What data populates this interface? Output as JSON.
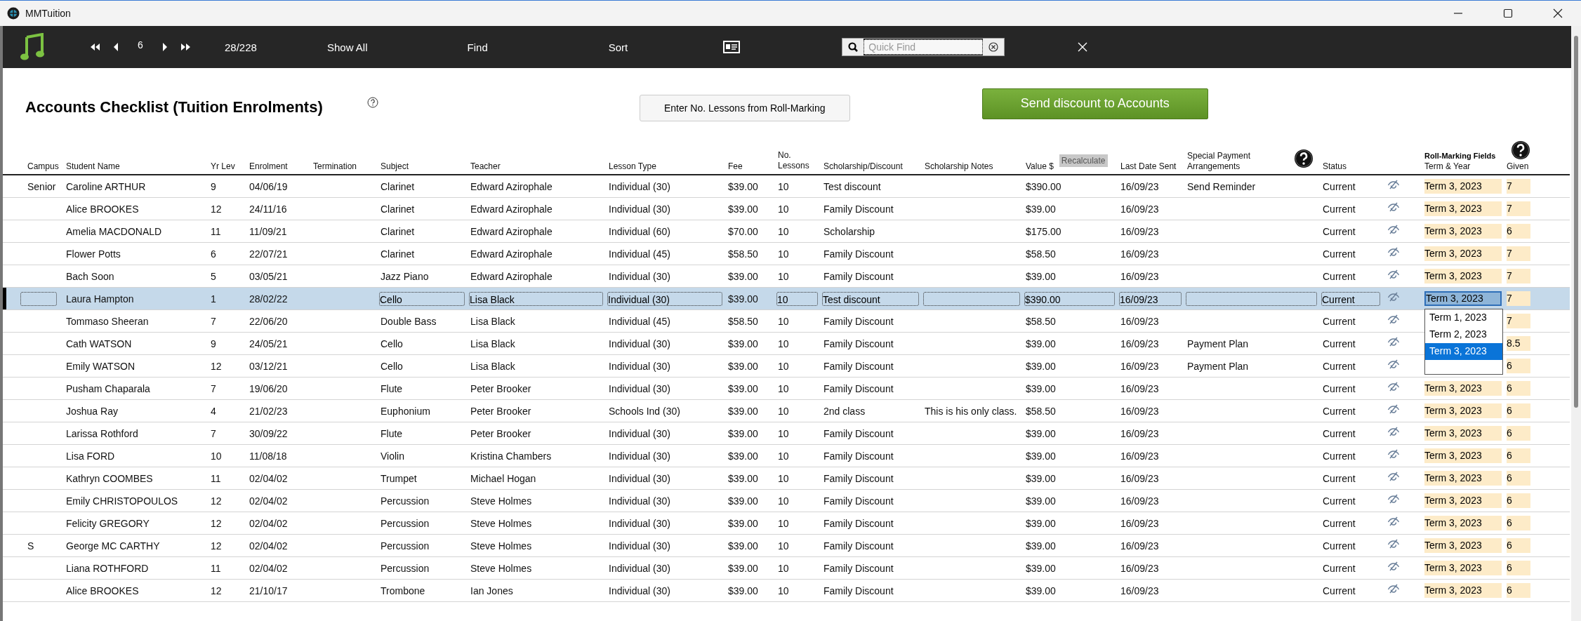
{
  "window": {
    "title": "MMTuition"
  },
  "toolbar": {
    "record": "6",
    "count": "28/228",
    "show_all": "Show All",
    "find": "Find",
    "sort": "Sort",
    "search": {
      "placeholder": "Quick Find"
    }
  },
  "page": {
    "title": "Accounts Checklist (Tuition Enrolments)",
    "lessons_button": "Enter No. Lessons from Roll-Marking",
    "send_button": "Send discount to Accounts"
  },
  "table": {
    "columns": [
      {
        "label": "Campus"
      },
      {
        "label": "Student Name"
      },
      {
        "label": "Yr Lev"
      },
      {
        "label": "Enrolment"
      },
      {
        "label": "Termination"
      },
      {
        "label": "Subject"
      },
      {
        "label": "Teacher"
      },
      {
        "label": "Lesson Type"
      },
      {
        "label": "Fee"
      },
      {
        "label": "No. Lessons"
      },
      {
        "label": "Scholarship/Discount"
      },
      {
        "label": "Scholarship Notes"
      },
      {
        "label": "Value $"
      },
      {
        "label": "Last Date Sent"
      },
      {
        "label": "Special Payment Arrangements"
      },
      {
        "label": "Status"
      },
      {
        "label": "Term & Year"
      },
      {
        "label": "Given"
      }
    ],
    "recalculate_button": "Recalculate",
    "group_label": "Roll-Marking Fields",
    "term_dropdown": {
      "options": [
        {
          "label": "Term 1, 2023",
          "selected": false
        },
        {
          "label": "Term 2, 2023",
          "selected": false
        },
        {
          "label": "Term 3, 2023",
          "selected": true
        }
      ]
    },
    "rows": [
      {
        "campus": "Senior",
        "name": "Caroline ARTHUR",
        "yr": "9",
        "enrolment": "04/06/19",
        "subject": "Clarinet",
        "teacher": "Edward Azirophale",
        "lesson_type": "Individual (30)",
        "fee": "$39.00",
        "lessons": "10",
        "scholarship": "Test discount",
        "value": "$390.00",
        "last_date": "16/09/23",
        "special": "Send Reminder",
        "status": "Current",
        "term": "Term 3, 2023",
        "given": "7",
        "selected": false
      },
      {
        "name": "Alice BROOKES",
        "yr": "12",
        "enrolment": "24/11/16",
        "subject": "Clarinet",
        "teacher": "Edward Azirophale",
        "lesson_type": "Individual (30)",
        "fee": "$39.00",
        "lessons": "10",
        "scholarship": "Family Discount",
        "value": "$39.00",
        "last_date": "16/09/23",
        "status": "Current",
        "term": "Term 3, 2023",
        "given": "7",
        "selected": false
      },
      {
        "name": "Amelia MACDONALD",
        "yr": "11",
        "enrolment": "11/09/21",
        "subject": "Clarinet",
        "teacher": "Edward Azirophale",
        "lesson_type": "Individual (60)",
        "fee": "$70.00",
        "lessons": "10",
        "scholarship": "Scholarship",
        "value": "$175.00",
        "last_date": "16/09/23",
        "status": "Current",
        "term": "Term 3, 2023",
        "given": "6",
        "selected": false
      },
      {
        "name": "Flower Potts",
        "yr": "6",
        "enrolment": "22/07/21",
        "subject": "Clarinet",
        "teacher": "Edward Azirophale",
        "lesson_type": "Individual (45)",
        "fee": "$58.50",
        "lessons": "10",
        "scholarship": "Family Discount",
        "value": "$58.50",
        "last_date": "16/09/23",
        "status": "Current",
        "term": "Term 3, 2023",
        "given": "7",
        "selected": false
      },
      {
        "name": "Bach Soon",
        "yr": "5",
        "enrolment": "03/05/21",
        "subject": "Jazz Piano",
        "teacher": "Edward Azirophale",
        "lesson_type": "Individual (30)",
        "fee": "$39.00",
        "lessons": "10",
        "scholarship": "Family Discount",
        "value": "$39.00",
        "last_date": "16/09/23",
        "status": "Current",
        "term": "Term 3, 2023",
        "given": "7",
        "selected": false
      },
      {
        "name": "Laura Hampton",
        "yr": "1",
        "enrolment": "28/02/22",
        "subject": "Cello",
        "teacher": "Lisa Black",
        "lesson_type": "Individual (30)",
        "fee": "$39.00",
        "lessons": "10",
        "scholarship": "Test discount",
        "value": "$390.00",
        "last_date": "16/09/23",
        "status": "Current",
        "term": "Term 3, 2023",
        "given": "7",
        "selected": true,
        "dropdown_open": true
      },
      {
        "name": "Tommaso Sheeran",
        "yr": "7",
        "enrolment": "22/06/20",
        "subject": "Double Bass",
        "teacher": "Lisa Black",
        "lesson_type": "Individual (45)",
        "fee": "$58.50",
        "lessons": "10",
        "scholarship": "Family Discount",
        "value": "$58.50",
        "last_date": "16/09/23",
        "status": "Current",
        "given": "7",
        "selected": false
      },
      {
        "name": "Cath WATSON",
        "yr": "9",
        "enrolment": "24/05/21",
        "subject": "Cello",
        "teacher": "Lisa Black",
        "lesson_type": "Individual (30)",
        "fee": "$39.00",
        "lessons": "10",
        "scholarship": "Family Discount",
        "value": "$39.00",
        "last_date": "16/09/23",
        "special": "Payment Plan",
        "status": "Current",
        "given": "8.5",
        "selected": false
      },
      {
        "name": "Emily WATSON",
        "yr": "12",
        "enrolment": "03/12/21",
        "subject": "Cello",
        "teacher": "Lisa Black",
        "lesson_type": "Individual (30)",
        "fee": "$39.00",
        "lessons": "10",
        "scholarship": "Family Discount",
        "value": "$39.00",
        "last_date": "16/09/23",
        "special": "Payment Plan",
        "status": "Current",
        "given": "6",
        "selected": false
      },
      {
        "name": "Pusham Chaparala",
        "yr": "7",
        "enrolment": "19/06/20",
        "subject": "Flute",
        "teacher": "Peter Brooker",
        "lesson_type": "Individual (30)",
        "fee": "$39.00",
        "lessons": "10",
        "scholarship": "Family Discount",
        "value": "$39.00",
        "last_date": "16/09/23",
        "status": "Current",
        "term": "Term 3, 2023",
        "given": "6",
        "selected": false
      },
      {
        "name": "Joshua Ray",
        "yr": "4",
        "enrolment": "21/02/23",
        "subject": "Euphonium",
        "teacher": "Peter Brooker",
        "lesson_type": "Schools Ind (30)",
        "fee": "$39.00",
        "lessons": "10",
        "scholarship": "2nd class",
        "notes": "This is his only class.",
        "value": "$58.50",
        "last_date": "16/09/23",
        "status": "Current",
        "term": "Term 3, 2023",
        "given": "6",
        "selected": false
      },
      {
        "name": "Larissa Rothford",
        "yr": "7",
        "enrolment": "30/09/22",
        "subject": "Flute",
        "teacher": "Peter Brooker",
        "lesson_type": "Individual (30)",
        "fee": "$39.00",
        "lessons": "10",
        "scholarship": "Family Discount",
        "value": "$39.00",
        "last_date": "16/09/23",
        "status": "Current",
        "term": "Term 3, 2023",
        "given": "6",
        "selected": false
      },
      {
        "name": "Lisa FORD",
        "yr": "10",
        "enrolment": "11/08/18",
        "subject": "Violin",
        "teacher": "Kristina Chambers",
        "lesson_type": "Individual (30)",
        "fee": "$39.00",
        "lessons": "10",
        "scholarship": "Family Discount",
        "value": "$39.00",
        "last_date": "16/09/23",
        "status": "Current",
        "term": "Term 3, 2023",
        "given": "6",
        "selected": false
      },
      {
        "name": "Kathryn COOMBES",
        "yr": "11",
        "enrolment": "02/04/02",
        "subject": "Trumpet",
        "teacher": "Michael Hogan",
        "lesson_type": "Individual (30)",
        "fee": "$39.00",
        "lessons": "10",
        "scholarship": "Family Discount",
        "value": "$39.00",
        "last_date": "16/09/23",
        "status": "Current",
        "term": "Term 3, 2023",
        "given": "6",
        "selected": false
      },
      {
        "name": "Emily CHRISTOPOULOS",
        "yr": "12",
        "enrolment": "02/04/02",
        "subject": "Percussion",
        "teacher": "Steve Holmes",
        "lesson_type": "Individual (30)",
        "fee": "$39.00",
        "lessons": "10",
        "scholarship": "Family Discount",
        "value": "$39.00",
        "last_date": "16/09/23",
        "status": "Current",
        "term": "Term 3, 2023",
        "given": "6",
        "selected": false
      },
      {
        "name": "Felicity GREGORY",
        "yr": "12",
        "enrolment": "02/04/02",
        "subject": "Percussion",
        "teacher": "Steve Holmes",
        "lesson_type": "Individual (30)",
        "fee": "$39.00",
        "lessons": "10",
        "scholarship": "Family Discount",
        "value": "$39.00",
        "last_date": "16/09/23",
        "status": "Current",
        "term": "Term 3, 2023",
        "given": "6",
        "selected": false
      },
      {
        "campus": "S",
        "name": "George MC CARTHY",
        "yr": "12",
        "enrolment": "02/04/02",
        "subject": "Percussion",
        "teacher": "Steve Holmes",
        "lesson_type": "Individual (30)",
        "fee": "$39.00",
        "lessons": "10",
        "scholarship": "Family Discount",
        "value": "$39.00",
        "last_date": "16/09/23",
        "status": "Current",
        "term": "Term 3, 2023",
        "given": "6",
        "selected": false
      },
      {
        "name": "Liana ROTHFORD",
        "yr": "11",
        "enrolment": "02/04/02",
        "subject": "Percussion",
        "teacher": "Steve Holmes",
        "lesson_type": "Individual (30)",
        "fee": "$39.00",
        "lessons": "10",
        "scholarship": "Family Discount",
        "value": "$39.00",
        "last_date": "16/09/23",
        "status": "Current",
        "term": "Term 3, 2023",
        "given": "6",
        "selected": false
      },
      {
        "name": "Alice BROOKES",
        "yr": "12",
        "enrolment": "21/10/17",
        "subject": "Trombone",
        "teacher": "Ian Jones",
        "lesson_type": "Individual (30)",
        "fee": "$39.00",
        "lessons": "10",
        "scholarship": "Family Discount",
        "value": "$39.00",
        "last_date": "16/09/23",
        "status": "Current",
        "term": "Term 3, 2023",
        "given": "6",
        "selected": false
      }
    ]
  }
}
